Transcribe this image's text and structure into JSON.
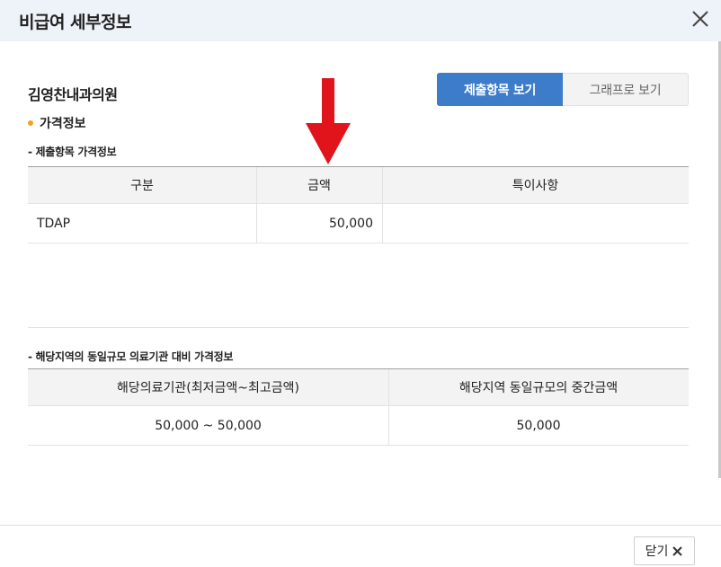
{
  "header": {
    "title": "비급여 세부정보"
  },
  "clinic": {
    "name": "김영찬내과의원"
  },
  "view_toggle": {
    "submit_label": "제출항목 보기",
    "graph_label": "그래프로 보기"
  },
  "section": {
    "title": "가격정보"
  },
  "submitted": {
    "title": "- 제출항목 가격정보",
    "headers": [
      "구분",
      "금액",
      "특이사항"
    ],
    "rows": [
      {
        "category": "TDAP",
        "amount": "50,000",
        "note": ""
      }
    ]
  },
  "regional": {
    "title": "- 해당지역의 동일규모 의료기관 대비 가격정보",
    "headers": [
      "해당의료기관(최저금액~최고금액)",
      "해당지역 동일규모의 중간금액"
    ],
    "rows": [
      {
        "range": "50,000 ~ 50,000",
        "median": "50,000"
      }
    ]
  },
  "footer": {
    "close_label": "닫기"
  },
  "colors": {
    "accent": "#3d7cc9",
    "bullet": "#f0a020",
    "arrow": "#e0141a"
  }
}
